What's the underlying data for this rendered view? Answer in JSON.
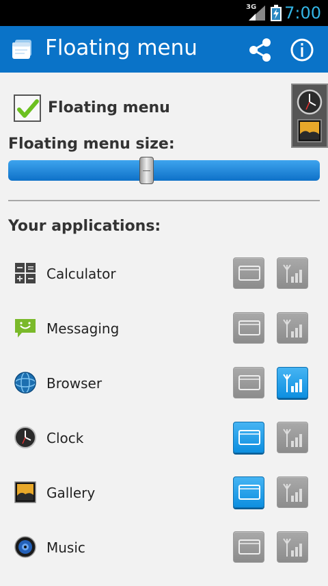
{
  "status_bar": {
    "network": "3G",
    "time": "7:00"
  },
  "action_bar": {
    "title": "Floating menu",
    "share_icon": "share-icon",
    "info_icon": "info-icon"
  },
  "settings": {
    "floating_menu_label": "Floating menu",
    "floating_menu_enabled": true,
    "size_label": "Floating menu size:",
    "size_value": 0.44
  },
  "apps_heading": "Your applications:",
  "apps": [
    {
      "name": "Calculator",
      "icon": "calculator-icon",
      "window_on": false,
      "signal_on": false
    },
    {
      "name": "Messaging",
      "icon": "messaging-icon",
      "window_on": false,
      "signal_on": false
    },
    {
      "name": "Browser",
      "icon": "browser-icon",
      "window_on": false,
      "signal_on": true
    },
    {
      "name": "Clock",
      "icon": "clock-icon",
      "window_on": true,
      "signal_on": false
    },
    {
      "name": "Gallery",
      "icon": "gallery-icon",
      "window_on": true,
      "signal_on": false
    },
    {
      "name": "Music",
      "icon": "music-icon",
      "window_on": false,
      "signal_on": false
    }
  ],
  "colors": {
    "action_bar": "#0a73c8",
    "accent": "#33b5e5",
    "check": "#6cc020"
  }
}
